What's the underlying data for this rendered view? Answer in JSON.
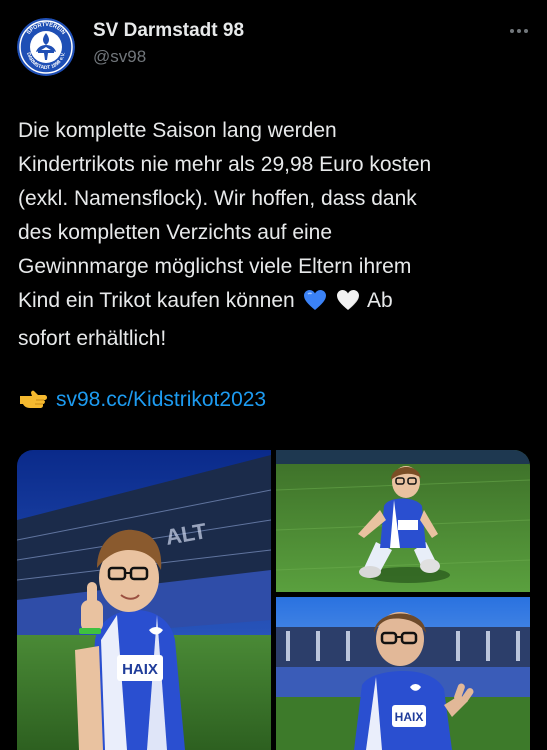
{
  "author": {
    "name": "SV Darmstadt 98",
    "handle": "@sv98",
    "avatar_icon": "club-crest-icon",
    "avatar_text_top": "SPORTVEREIN",
    "avatar_text_bottom": "DARMSTADT 1898 e.V."
  },
  "more_icon": "more-options-icon",
  "tweet": {
    "text": "Die komplette Saison lang werden\nKindertrikots nie mehr als 29,98 Euro kosten\n(exkl. Namensflock). Wir hoffen, dass dank\ndes kompletten Verzichts auf eine\nGewinnmarge möglichst viele Eltern ihrem\nKind ein Trikot kaufen können",
    "after_emoji": " Ab\nsofort erhältlich!",
    "link_text": "sv98.cc/Kidstrikot2023",
    "emoji": [
      "blue-heart-icon",
      "white-heart-icon",
      "pointing-hand-icon"
    ]
  },
  "media": {
    "photos": [
      {
        "label": "boy-thumbs-up-stadium",
        "shirt_text": "HAIX",
        "stand_text": "STADION AM BÖLLENFALLTOR"
      },
      {
        "label": "boy-sitting-on-pitch"
      },
      {
        "label": "boy-in-stadium-closeup",
        "shirt_text": "HAIX"
      }
    ]
  },
  "colors": {
    "background": "#000000",
    "text": "#e7e9ea",
    "secondary": "#71767b",
    "link": "#1d9bf0",
    "club_blue": "#1f4fb5"
  }
}
